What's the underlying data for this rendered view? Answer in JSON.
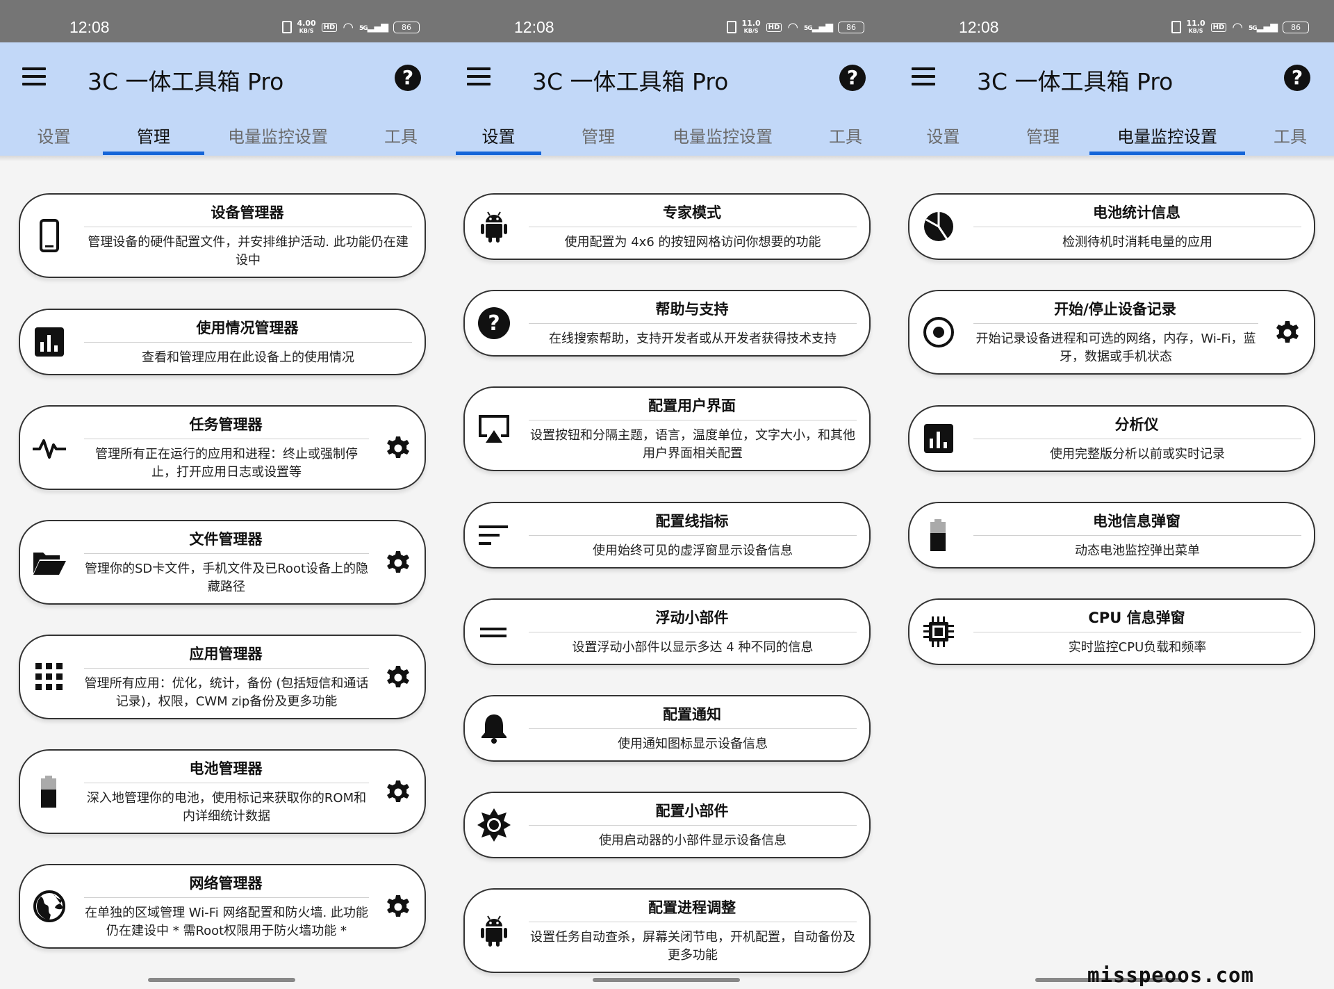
{
  "status": {
    "time": "12:08",
    "battery": "86",
    "sig": "5G",
    "hd": "HD"
  },
  "panels": [
    {
      "speed": "4.00",
      "speed_unit": "KB/S",
      "app_title": "3C 一体工具箱 Pro",
      "tabs": [
        "设置",
        "管理",
        "电量监控设置",
        "工具"
      ],
      "active_tab": 1,
      "cards": [
        {
          "title": "设备管理器",
          "desc": "管理设备的硬件配置文件，并安排维护活动. 此功能仍在建设中",
          "icon": "phone-icon",
          "gear": false
        },
        {
          "title": "使用情况管理器",
          "desc": "查看和管理应用在此设备上的使用情况",
          "icon": "bar-chart-icon",
          "gear": false
        },
        {
          "title": "任务管理器",
          "desc": "管理所有正在运行的应用和进程：终止或强制停止，打开应用日志或设置等",
          "icon": "pulse-icon",
          "gear": true
        },
        {
          "title": "文件管理器",
          "desc": "管理你的SD卡文件，手机文件及已Root设备上的隐藏路径",
          "icon": "folder-open-icon",
          "gear": true
        },
        {
          "title": "应用管理器",
          "desc": "管理所有应用：优化，统计，备份 (包括短信和通话记录)，权限，CWM zip备份及更多功能",
          "icon": "apps-grid-icon",
          "gear": true
        },
        {
          "title": "电池管理器",
          "desc": "深入地管理你的电池，使用标记来获取你的ROM和内详细统计数据",
          "icon": "battery-icon",
          "gear": true
        },
        {
          "title": "网络管理器",
          "desc": "在单独的区域管理 Wi-Fi 网络配置和防火墙. 此功能仍在建设中 * 需Root权限用于防火墙功能 *",
          "icon": "globe-icon",
          "gear": true
        }
      ]
    },
    {
      "speed": "11.0",
      "speed_unit": "KB/S",
      "app_title": "3C 一体工具箱 Pro",
      "tabs": [
        "设置",
        "管理",
        "电量监控设置",
        "工具"
      ],
      "active_tab": 0,
      "cards": [
        {
          "title": "专家模式",
          "desc": "使用配置为 4x6 的按钮网格访问你想要的功能",
          "icon": "android-icon",
          "gear": false
        },
        {
          "title": "帮助与支持",
          "desc": "在线搜索帮助，支持开发者或从开发者获得技术支持",
          "icon": "help-circle-icon",
          "gear": false
        },
        {
          "title": "配置用户界面",
          "desc": "设置按钮和分隔主题，语言，温度单位，文字大小，和其他用户界面相关配置",
          "icon": "airplay-icon",
          "gear": false
        },
        {
          "title": "配置线指标",
          "desc": "使用始终可见的虚浮窗显示设备信息",
          "icon": "lines-icon",
          "gear": false
        },
        {
          "title": "浮动小部件",
          "desc": "设置浮动小部件以显示多达 4 种不同的信息",
          "icon": "equals-icon",
          "gear": false
        },
        {
          "title": "配置通知",
          "desc": "使用通知图标显示设备信息",
          "icon": "bell-icon",
          "gear": false
        },
        {
          "title": "配置小部件",
          "desc": "使用启动器的小部件显示设备信息",
          "icon": "brightness-icon",
          "gear": false
        },
        {
          "title": "配置进程调整",
          "desc": "设置任务自动查杀，屏幕关闭节电，开机配置，自动备份及更多功能",
          "icon": "android-icon",
          "gear": false
        }
      ]
    },
    {
      "speed": "11.0",
      "speed_unit": "KB/S",
      "app_title": "3C 一体工具箱 Pro",
      "tabs": [
        "设置",
        "管理",
        "电量监控设置",
        "工具"
      ],
      "active_tab": 2,
      "cards": [
        {
          "title": "电池统计信息",
          "desc": "检测待机时消耗电量的应用",
          "icon": "pie-icon",
          "gear": false
        },
        {
          "title": "开始/停止设备记录",
          "desc": "开始记录设备进程和可选的网络，内存，Wi-Fi，蓝牙，数据或手机状态",
          "icon": "record-icon",
          "gear": true
        },
        {
          "title": "分析仪",
          "desc": "使用完整版分析以前或实时记录",
          "icon": "bar-chart-icon",
          "gear": false
        },
        {
          "title": "电池信息弹窗",
          "desc": "动态电池监控弹出菜单",
          "icon": "battery-icon",
          "gear": false
        },
        {
          "title": "CPU 信息弹窗",
          "desc": "实时监控CPU负载和频率",
          "icon": "cpu-icon",
          "gear": false
        }
      ]
    }
  ],
  "watermark": "misspeoos.com"
}
